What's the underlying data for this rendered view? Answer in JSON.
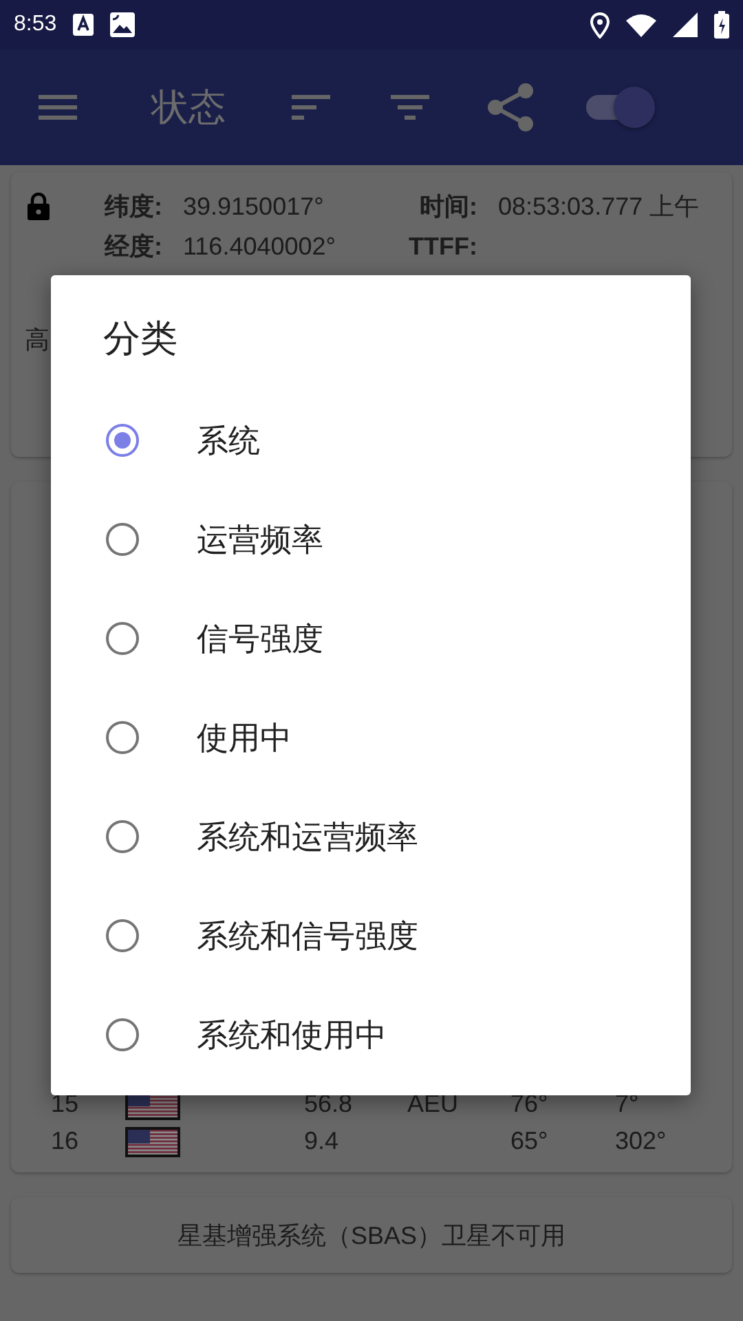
{
  "status_bar": {
    "time": "8:53"
  },
  "app_bar": {
    "title": "状态",
    "toggle_on": true
  },
  "location_card": {
    "fields": [
      {
        "label": "纬度:",
        "value": "39.9150017°"
      },
      {
        "label": "时间:",
        "value": "08:53:03.777 上午"
      },
      {
        "label": "经度:",
        "value": "116.4040002°"
      },
      {
        "label": "TTFF:"
      }
    ],
    "partial_label": "高"
  },
  "satellites": [
    {
      "id": "15",
      "cn0": "56.8",
      "flags": "AEU",
      "elevation": "76°",
      "azimuth": "7°"
    },
    {
      "id": "16",
      "cn0": "9.4",
      "elevation": "65°",
      "azimuth": "302°"
    }
  ],
  "sbas_message": "星基增强系统（SBAS）卫星不可用",
  "dialog": {
    "title": "分类",
    "options": [
      {
        "label": "系统",
        "selected": true
      },
      {
        "label": "运营频率",
        "selected": false
      },
      {
        "label": "信号强度",
        "selected": false
      },
      {
        "label": "使用中",
        "selected": false
      },
      {
        "label": "系统和运营频率",
        "selected": false
      },
      {
        "label": "系统和信号强度",
        "selected": false
      },
      {
        "label": "系统和使用中",
        "selected": false
      }
    ]
  }
}
